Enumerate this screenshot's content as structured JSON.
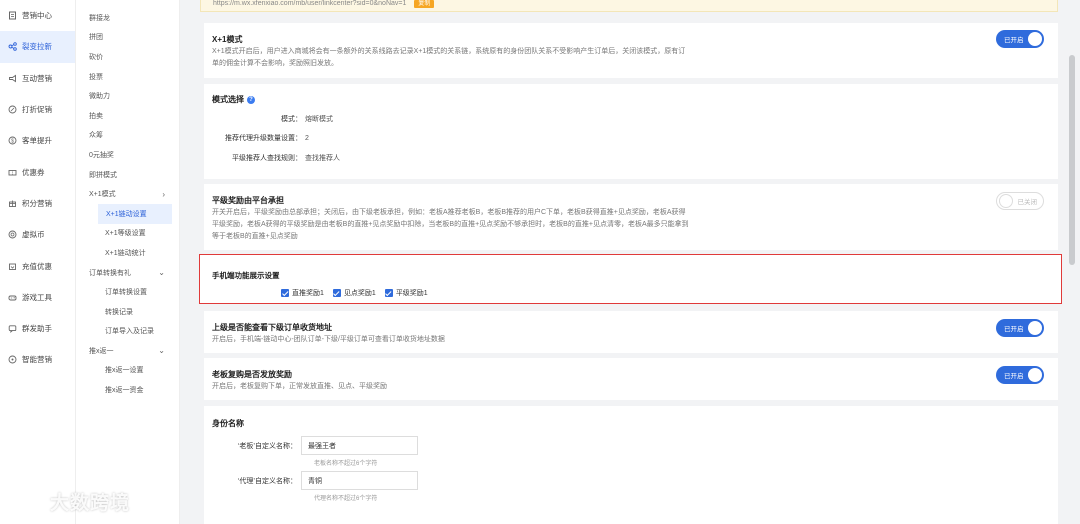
{
  "sidebar": {
    "items": [
      {
        "label": "营销中心",
        "icon": "doc-icon"
      },
      {
        "label": "裂变拉新",
        "icon": "share-icon",
        "active": true
      },
      {
        "label": "互动营销",
        "icon": "megaphone-icon"
      },
      {
        "label": "打折促销",
        "icon": "discount-icon"
      },
      {
        "label": "客单提升",
        "icon": "dollar-icon"
      },
      {
        "label": "优惠券",
        "icon": "coupon-icon"
      },
      {
        "label": "积分营销",
        "icon": "points-icon"
      },
      {
        "label": "虚拟币",
        "icon": "coin-icon"
      },
      {
        "label": "充值优惠",
        "icon": "recharge-icon"
      },
      {
        "label": "游戏工具",
        "icon": "game-icon"
      },
      {
        "label": "群发助手",
        "icon": "chat-icon"
      },
      {
        "label": "智能营销",
        "icon": "smart-icon"
      }
    ]
  },
  "subnav": {
    "items": [
      {
        "label": "群接龙",
        "kind": "item"
      },
      {
        "label": "拼团",
        "kind": "item"
      },
      {
        "label": "砍价",
        "kind": "item"
      },
      {
        "label": "投票",
        "kind": "item"
      },
      {
        "label": "微助力",
        "kind": "item"
      },
      {
        "label": "拍卖",
        "kind": "item"
      },
      {
        "label": "众筹",
        "kind": "item"
      },
      {
        "label": "0元抽奖",
        "kind": "item"
      },
      {
        "label": "即拼模式",
        "kind": "item"
      },
      {
        "label": "X+1模式",
        "kind": "group",
        "chevron": "›"
      },
      {
        "label": "X+1链动设置",
        "kind": "active"
      },
      {
        "label": "X+1等级设置",
        "kind": "child"
      },
      {
        "label": "X+1链动统计",
        "kind": "child"
      },
      {
        "label": "订单转换有礼",
        "kind": "group",
        "chevron": "⌄"
      },
      {
        "label": "订单转换设置",
        "kind": "child"
      },
      {
        "label": "转换记录",
        "kind": "child"
      },
      {
        "label": "订单导入及记录",
        "kind": "child"
      },
      {
        "label": "推x返一",
        "kind": "group",
        "chevron": "⌄"
      },
      {
        "label": "推x返一设置",
        "kind": "child"
      },
      {
        "label": "推x返一资金",
        "kind": "child"
      }
    ]
  },
  "urlbar": {
    "text": "https://m.wx.xfenxiao.com/mb/user/linkcenter?sid=0&noNav=1",
    "tag": "复制"
  },
  "x1": {
    "title": "X+1模式",
    "desc": "X+1模式开启后，用户进入商城将会有一条额外的关系线路去记录X+1模式的关系链，系统原有的身份团队关系不受影响产生订单后，关闭该模式，原有订单的佣金计算不会影响，奖励照旧发放。",
    "toggle": "已开启"
  },
  "mode": {
    "title": "模式选择",
    "help": "?",
    "rows": [
      {
        "label": "模式：",
        "value": "熔断模式"
      },
      {
        "label": "推荐代理升级数量设置：",
        "value": "2"
      },
      {
        "label": "平级推荐人查找规则：",
        "value": "查找推荐人"
      }
    ]
  },
  "flat": {
    "title": "平级奖励由平台承担",
    "desc": "开关开启后，平级奖励由总部承担；关闭后，由下级老板承担，例如：老板A推荐老板B，老板B推荐的用户C下单，老板B获得直推+见点奖励，老板A获得平级奖励，老板A获得的平级奖励是由老板B的直推+见点奖励中扣除，当老板B的直推+见点奖励不够承担时，老板B的直推+见点清零，老板A最多只能拿到等于老板B的直推+见点奖励",
    "toggle": "已关闭"
  },
  "mobile": {
    "title": "手机端功能展示设置",
    "checks": [
      "直推奖励1",
      "见点奖励1",
      "平级奖励1"
    ]
  },
  "orders": {
    "title": "上级是否能查看下级订单收货地址",
    "desc": "开启后，手机端-链动中心-团队订单-下级/平级订单可查看订单收货地址数据",
    "toggle": "已开启"
  },
  "repurchase": {
    "title": "老板复购是否发放奖励",
    "desc": "开启后，老板复购下单，正常发放直推、见点、平级奖励",
    "toggle": "已开启"
  },
  "identity": {
    "title": "身份名称",
    "boss_label": "‘老板’自定义名称：",
    "boss_value": "最强王者",
    "boss_hint": "老板名称不超过6个字符",
    "agent_label": "‘代理’自定义名称：",
    "agent_value": "青铜",
    "agent_hint": "代理名称不超过6个字符"
  },
  "watermark": {
    "text": "大数跨境"
  },
  "colors": {
    "accent": "#2f6bdc",
    "highlight_border": "#e03a3a"
  }
}
